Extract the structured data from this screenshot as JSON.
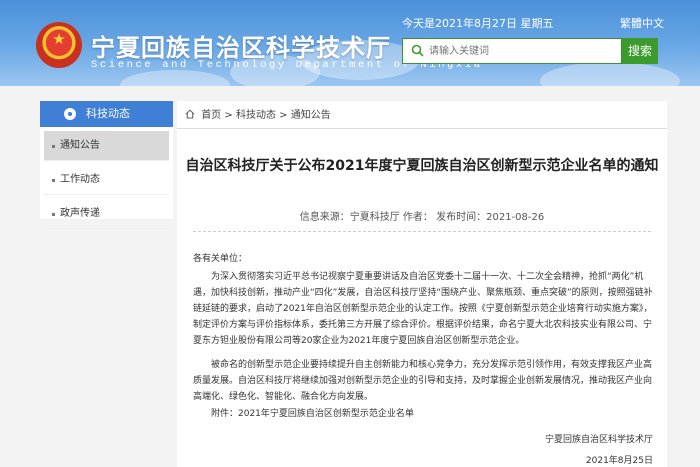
{
  "header": {
    "title_cn": "宁夏回族自治区科学技术厅",
    "title_en": "Science and Technology Department of Ningxia",
    "date": "今天是2021年8月27日 星期五",
    "traditional_link": "繁體中文",
    "search": {
      "placeholder": "请输入关键词",
      "button_label": "搜索"
    }
  },
  "sidebar": {
    "heading": "科技动态",
    "items": [
      {
        "label": "通知公告",
        "active": true
      },
      {
        "label": "工作动态",
        "active": false
      },
      {
        "label": "政声传递",
        "active": false
      }
    ]
  },
  "breadcrumb": {
    "home": "首页",
    "sep": ">",
    "level1": "科技动态",
    "level2": "通知公告"
  },
  "article": {
    "title": "自治区科技厅关于公布2021年度宁夏回族自治区创新型示范企业名单的通知",
    "meta": "信息来源：宁夏科技厅   作者：   发布时间：2021-08-26",
    "salutation": "各有关单位：",
    "paragraph1": "为深入贯彻落实习近平总书记视察宁夏重要讲话及自治区党委十二届十一次、十二次全会精神，抢抓“两化”机遇，加快科技创新，推动产业“四化”发展，自治区科技厅坚持“围绕产业、聚焦瓶颈、重点突破”的原则，按照强链补链延链的要求，启动了2021年自治区创新型示范企业的认定工作。按照《宁夏创新型示范企业培育行动实施方案》，制定评价方案与评价指标体系，委托第三方开展了综合评价。根据评价结果，命名宁夏大北农科技实业有限公司、宁夏东方钽业股份有限公司等20家企业为2021年度宁夏回族自治区创新型示范企业。",
    "paragraph2": "被命名的创新型示范企业要持续提升自主创新能力和核心竞争力，充分发挥示范引领作用，有效支撑我区产业高质量发展。自治区科技厅将继续加强对创新型示范企业的引导和支持，及时掌握企业创新发展情况，推动我区产业向高端化、绿色化、智能化、融合化方向发展。",
    "attachment": "附件：2021年宁夏回族自治区创新型示范企业名单",
    "signature": "宁夏回族自治区科学技术厅",
    "sign_date": "2021年8月25日"
  },
  "colors": {
    "header_blue": "#4a90d9",
    "sidebar_head": "#3f7fd6",
    "search_green": "#3d9b2d"
  },
  "icons": [
    "national-emblem-icon",
    "search-icon",
    "home-icon",
    "bullet-icon"
  ]
}
